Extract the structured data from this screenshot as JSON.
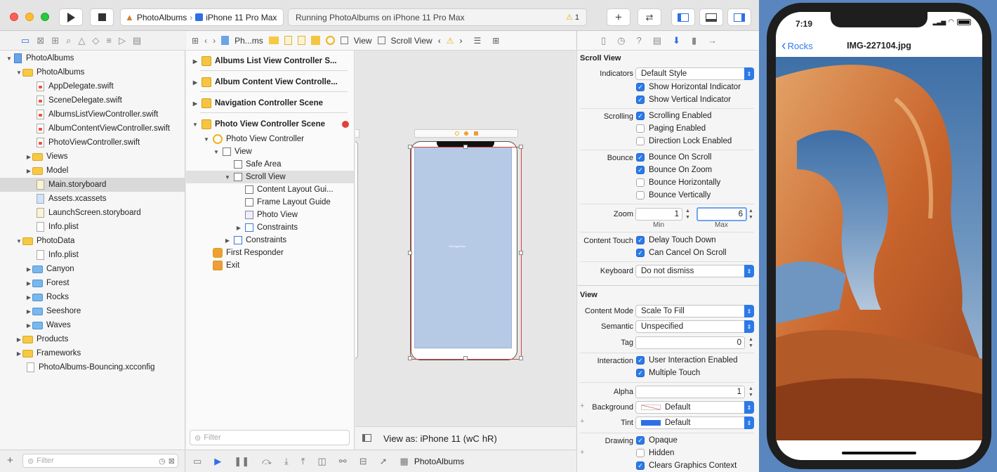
{
  "toolbar": {
    "run_icon": "play-icon",
    "stop_icon": "stop-icon",
    "scheme_app": "PhotoAlbums",
    "scheme_device": "iPhone 11 Pro Max",
    "status_text": "Running PhotoAlbums on iPhone 11 Pro Max",
    "warning_count": "1",
    "add_label": "+"
  },
  "navigator": {
    "items": [
      {
        "label": "PhotoAlbums",
        "kind": "project"
      },
      {
        "label": "PhotoAlbums",
        "kind": "folder"
      },
      {
        "label": "AppDelegate.swift",
        "kind": "swift"
      },
      {
        "label": "SceneDelegate.swift",
        "kind": "swift"
      },
      {
        "label": "AlbumsListViewController.swift",
        "kind": "swift"
      },
      {
        "label": "AlbumContentViewController.swift",
        "kind": "swift"
      },
      {
        "label": "PhotoViewController.swift",
        "kind": "swift"
      },
      {
        "label": "Views",
        "kind": "folder"
      },
      {
        "label": "Model",
        "kind": "folder"
      },
      {
        "label": "Main.storyboard",
        "kind": "file"
      },
      {
        "label": "Assets.xcassets",
        "kind": "file"
      },
      {
        "label": "LaunchScreen.storyboard",
        "kind": "file"
      },
      {
        "label": "Info.plist",
        "kind": "file"
      },
      {
        "label": "PhotoData",
        "kind": "folder"
      },
      {
        "label": "Info.plist",
        "kind": "file"
      },
      {
        "label": "Canyon",
        "kind": "bluefolder"
      },
      {
        "label": "Forest",
        "kind": "bluefolder"
      },
      {
        "label": "Rocks",
        "kind": "bluefolder"
      },
      {
        "label": "Seeshore",
        "kind": "bluefolder"
      },
      {
        "label": "Waves",
        "kind": "bluefolder"
      },
      {
        "label": "Products",
        "kind": "folder"
      },
      {
        "label": "Frameworks",
        "kind": "folder"
      },
      {
        "label": "PhotoAlbums-Bouncing.xcconfig",
        "kind": "file"
      }
    ],
    "filter_placeholder": "Filter"
  },
  "jumpbar": {
    "project": "Ph...ms",
    "view": "View",
    "scroll_view": "Scroll View"
  },
  "outline": {
    "scenes": [
      "Albums List View Controller S...",
      "Album Content View Controlle...",
      "Navigation Controller Scene",
      "Photo View Controller Scene"
    ],
    "items": [
      "Photo View Controller",
      "View",
      "Safe Area",
      "Scroll View",
      "Content Layout Gui...",
      "Frame Layout Guide",
      "Photo View",
      "Constraints",
      "Constraints",
      "First Responder",
      "Exit"
    ],
    "filter_placeholder": "Filter"
  },
  "canvas": {
    "view_as_prefix": "View as: iPhone 11 (",
    "view_as_w": "wC",
    "view_as_h": "hR",
    "view_as_suffix": ")",
    "image_view_label": "UIImageView"
  },
  "bottombar": {
    "target": "PhotoAlbums"
  },
  "inspector": {
    "scroll_view_header": "Scroll View",
    "indicators_label": "Indicators",
    "indicators_value": "Default Style",
    "show_horizontal": "Show Horizontal Indicator",
    "show_vertical": "Show Vertical Indicator",
    "scrolling_label": "Scrolling",
    "scrolling_enabled": "Scrolling Enabled",
    "paging_enabled": "Paging Enabled",
    "direction_lock": "Direction Lock Enabled",
    "bounce_label": "Bounce",
    "bounce_on_scroll": "Bounce On Scroll",
    "bounce_on_zoom": "Bounce On Zoom",
    "bounce_horizontally": "Bounce Horizontally",
    "bounce_vertically": "Bounce Vertically",
    "zoom_label": "Zoom",
    "zoom_min": "1",
    "zoom_max": "6",
    "min_label": "Min",
    "max_label": "Max",
    "content_touch_label": "Content Touch",
    "delay_touch_down": "Delay Touch Down",
    "can_cancel_on_scroll": "Can Cancel On Scroll",
    "keyboard_label": "Keyboard",
    "keyboard_value": "Do not dismiss",
    "view_header": "View",
    "content_mode_label": "Content Mode",
    "content_mode_value": "Scale To Fill",
    "semantic_label": "Semantic",
    "semantic_value": "Unspecified",
    "tag_label": "Tag",
    "tag_value": "0",
    "interaction_label": "Interaction",
    "user_interaction": "User Interaction Enabled",
    "multiple_touch": "Multiple Touch",
    "alpha_label": "Alpha",
    "alpha_value": "1",
    "background_label": "Background",
    "background_value": "Default",
    "tint_label": "Tint",
    "tint_value": "Default",
    "drawing_label": "Drawing",
    "opaque": "Opaque",
    "hidden": "Hidden",
    "clears_graphics": "Clears Graphics Context",
    "tint_color": "#2f6fe6"
  },
  "simulator": {
    "time": "7:19",
    "back_label": "Rocks",
    "title": "IMG-227104.jpg"
  }
}
